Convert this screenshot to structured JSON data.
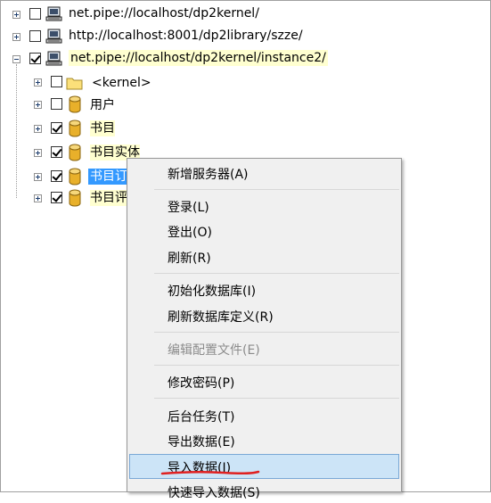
{
  "tree": {
    "servers": [
      {
        "label": "net.pipe://localhost/dp2kernel/",
        "checked": false,
        "expanded": false
      },
      {
        "label": "http://localhost:8001/dp2library/szze/",
        "checked": false,
        "expanded": false
      },
      {
        "label": "net.pipe://localhost/dp2kernel/instance2/",
        "checked": true,
        "expanded": true
      }
    ],
    "children": [
      {
        "label": "<kernel>",
        "checked": false,
        "icon": "folder"
      },
      {
        "label": "用户",
        "checked": false,
        "icon": "database"
      },
      {
        "label": "书目",
        "checked": true,
        "icon": "database"
      },
      {
        "label": "书目实体",
        "checked": true,
        "icon": "database"
      },
      {
        "label": "书目订",
        "checked": true,
        "icon": "database"
      },
      {
        "label": "书目评",
        "checked": true,
        "icon": "database"
      }
    ]
  },
  "context_menu": {
    "items": [
      {
        "label": "新增服务器(A)",
        "enabled": true
      },
      {
        "label": "登录(L)",
        "enabled": true
      },
      {
        "label": "登出(O)",
        "enabled": true
      },
      {
        "label": "刷新(R)",
        "enabled": true
      },
      {
        "label": "初始化数据库(I)",
        "enabled": true
      },
      {
        "label": "刷新数据库定义(R)",
        "enabled": true
      },
      {
        "label": "编辑配置文件(E)",
        "enabled": false
      },
      {
        "label": "修改密码(P)",
        "enabled": true
      },
      {
        "label": "后台任务(T)",
        "enabled": true
      },
      {
        "label": "导出数据(E)",
        "enabled": true
      },
      {
        "label": "导入数据(I)",
        "enabled": true,
        "hover": true
      },
      {
        "label": "快速导入数据(S)",
        "enabled": true
      }
    ]
  },
  "colors": {
    "selection": "#3399ff",
    "menu_hover": "#cce4f7",
    "highlight_label": "#ffffd0",
    "annotation_red": "#e02020",
    "database_gold": "#e8b02a"
  }
}
